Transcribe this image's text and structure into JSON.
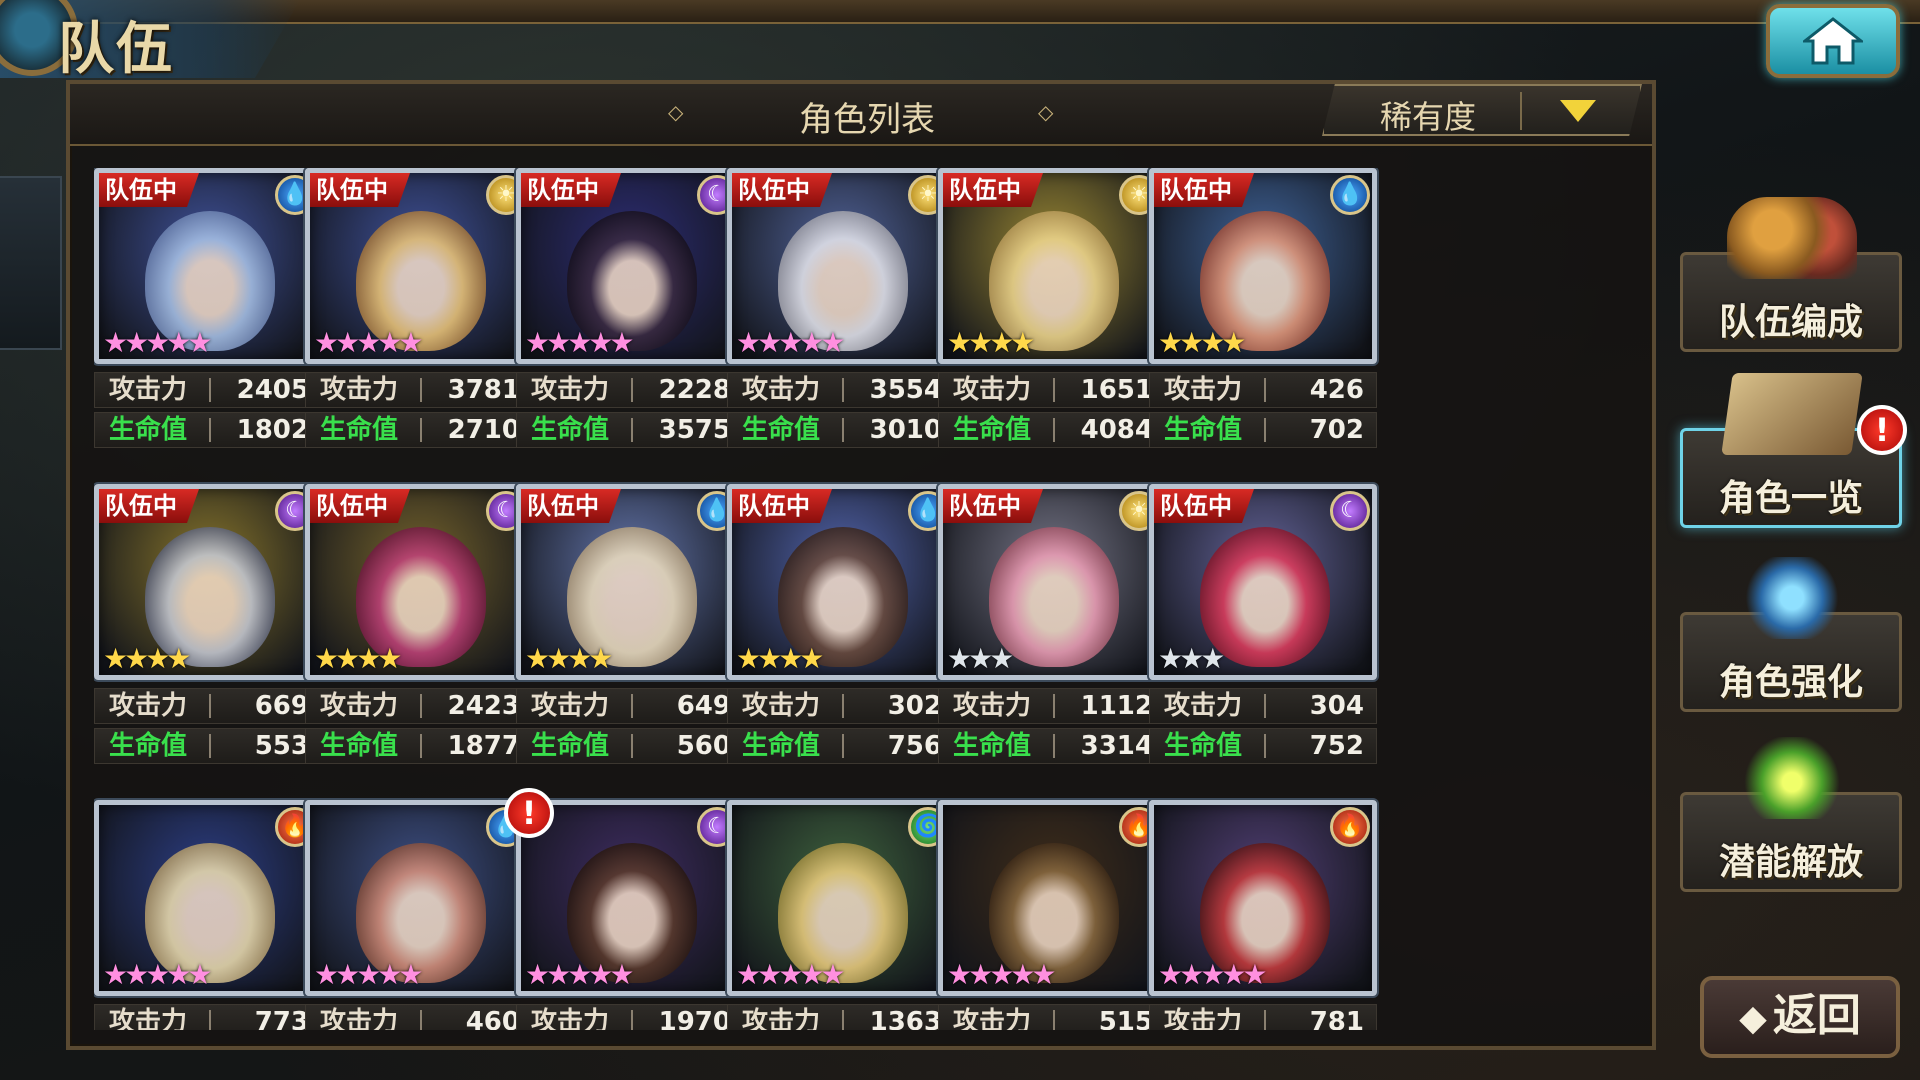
{
  "header": {
    "title": "队伍",
    "list_title": "角色列表",
    "sort_label": "稀有度",
    "home_icon": "home-icon"
  },
  "labels": {
    "team_tag": "队伍中",
    "attack": "攻击力",
    "hp": "生命值",
    "alert": "!"
  },
  "colors": {
    "team_tag": "#d82a24",
    "hp_label": "#39e04c",
    "sort_arrow": "#f2d33a",
    "home_accent": "#1b8fa3"
  },
  "characters": [
    {
      "in_team": true,
      "element": "water",
      "stars": 5,
      "star_color": "purple",
      "attack": "2405",
      "hp": "1802",
      "alert": false
    },
    {
      "in_team": true,
      "element": "light",
      "stars": 5,
      "star_color": "purple",
      "attack": "3781",
      "hp": "2710",
      "alert": false
    },
    {
      "in_team": true,
      "element": "dark",
      "stars": 5,
      "star_color": "purple",
      "attack": "2228",
      "hp": "3575",
      "alert": false
    },
    {
      "in_team": true,
      "element": "light",
      "stars": 5,
      "star_color": "purple",
      "attack": "3554",
      "hp": "3010",
      "alert": false
    },
    {
      "in_team": true,
      "element": "light",
      "stars": 4,
      "star_color": "gold",
      "attack": "1651",
      "hp": "4084",
      "alert": false
    },
    {
      "in_team": true,
      "element": "water",
      "stars": 4,
      "star_color": "gold",
      "attack": "426",
      "hp": "702",
      "alert": false
    },
    {
      "in_team": true,
      "element": "dark",
      "stars": 4,
      "star_color": "gold",
      "attack": "669",
      "hp": "553",
      "alert": false
    },
    {
      "in_team": true,
      "element": "dark",
      "stars": 4,
      "star_color": "gold",
      "attack": "2423",
      "hp": "1877",
      "alert": false
    },
    {
      "in_team": true,
      "element": "water",
      "stars": 4,
      "star_color": "gold",
      "attack": "649",
      "hp": "560",
      "alert": false
    },
    {
      "in_team": true,
      "element": "water",
      "stars": 4,
      "star_color": "gold",
      "attack": "302",
      "hp": "756",
      "alert": false
    },
    {
      "in_team": true,
      "element": "light",
      "stars": 3,
      "star_color": "silver",
      "attack": "1112",
      "hp": "3314",
      "alert": false
    },
    {
      "in_team": true,
      "element": "dark",
      "stars": 3,
      "star_color": "silver",
      "attack": "304",
      "hp": "752",
      "alert": false
    },
    {
      "in_team": false,
      "element": "fire",
      "stars": 5,
      "star_color": "purple",
      "attack": "773",
      "hp": "",
      "alert": false
    },
    {
      "in_team": false,
      "element": "water",
      "stars": 5,
      "star_color": "purple",
      "attack": "460",
      "hp": "",
      "alert": false
    },
    {
      "in_team": false,
      "element": "dark",
      "stars": 5,
      "star_color": "purple",
      "attack": "1970",
      "hp": "",
      "alert": true
    },
    {
      "in_team": false,
      "element": "wind",
      "stars": 5,
      "star_color": "purple",
      "attack": "1363",
      "hp": "",
      "alert": false
    },
    {
      "in_team": false,
      "element": "fire",
      "stars": 5,
      "star_color": "purple",
      "attack": "515",
      "hp": "",
      "alert": false
    },
    {
      "in_team": false,
      "element": "fire",
      "stars": 5,
      "star_color": "purple",
      "attack": "781",
      "hp": "",
      "alert": false
    }
  ],
  "menu": {
    "team_edit": "队伍编成",
    "character_list": "角色一览",
    "character_enhance": "角色强化",
    "potential_unlock": "潜能解放",
    "back": "返回"
  }
}
